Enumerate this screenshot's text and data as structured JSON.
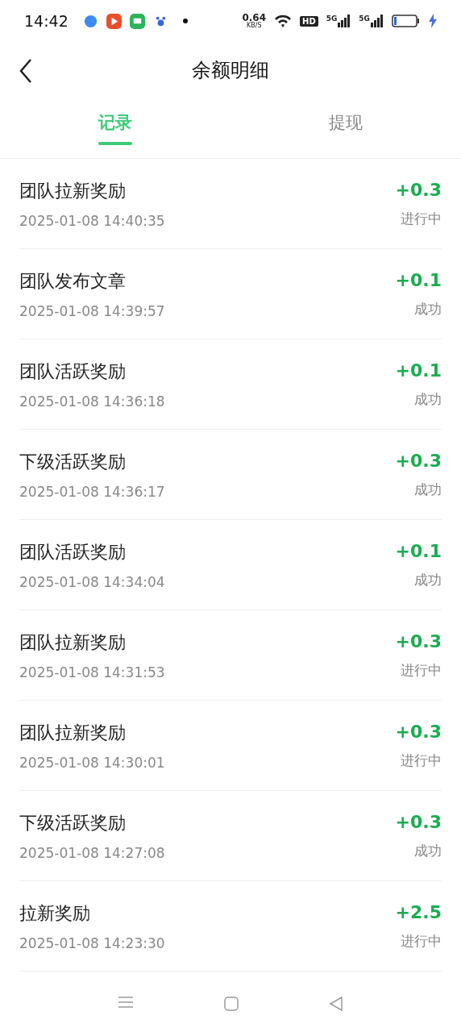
{
  "status_bar": {
    "time": "14:42",
    "speed": "0.64",
    "speed_unit": "KB/S",
    "hd": "HD",
    "networks": [
      "5G",
      "5G"
    ]
  },
  "header": {
    "title": "余额明细"
  },
  "tabs": [
    {
      "label": "记录",
      "selected": true
    },
    {
      "label": "提现",
      "selected": false
    }
  ],
  "records": [
    {
      "title": "团队拉新奖励",
      "time": "2025-01-08 14:40:35",
      "amount": "+0.3",
      "status": "进行中"
    },
    {
      "title": "团队发布文章",
      "time": "2025-01-08 14:39:57",
      "amount": "+0.1",
      "status": "成功"
    },
    {
      "title": "团队活跃奖励",
      "time": "2025-01-08 14:36:18",
      "amount": "+0.1",
      "status": "成功"
    },
    {
      "title": "下级活跃奖励",
      "time": "2025-01-08 14:36:17",
      "amount": "+0.3",
      "status": "成功"
    },
    {
      "title": "团队活跃奖励",
      "time": "2025-01-08 14:34:04",
      "amount": "+0.1",
      "status": "成功"
    },
    {
      "title": "团队拉新奖励",
      "time": "2025-01-08 14:31:53",
      "amount": "+0.3",
      "status": "进行中"
    },
    {
      "title": "团队拉新奖励",
      "time": "2025-01-08 14:30:01",
      "amount": "+0.3",
      "status": "进行中"
    },
    {
      "title": "下级活跃奖励",
      "time": "2025-01-08 14:27:08",
      "amount": "+0.3",
      "status": "成功"
    },
    {
      "title": "拉新奖励",
      "time": "2025-01-08 14:23:30",
      "amount": "+2.5",
      "status": "进行中"
    }
  ]
}
